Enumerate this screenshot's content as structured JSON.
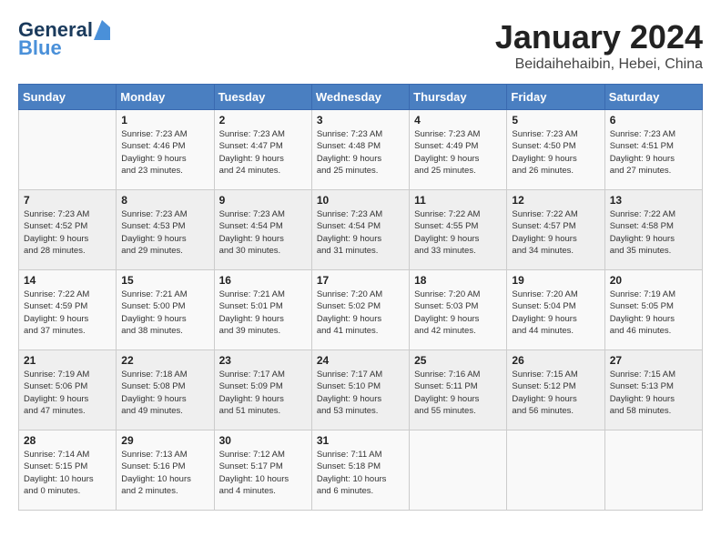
{
  "header": {
    "logo_general": "General",
    "logo_blue": "Blue",
    "month_title": "January 2024",
    "location": "Beidaihehaibin, Hebei, China"
  },
  "days_of_week": [
    "Sunday",
    "Monday",
    "Tuesday",
    "Wednesday",
    "Thursday",
    "Friday",
    "Saturday"
  ],
  "weeks": [
    [
      {
        "day": "",
        "info": ""
      },
      {
        "day": "1",
        "info": "Sunrise: 7:23 AM\nSunset: 4:46 PM\nDaylight: 9 hours\nand 23 minutes."
      },
      {
        "day": "2",
        "info": "Sunrise: 7:23 AM\nSunset: 4:47 PM\nDaylight: 9 hours\nand 24 minutes."
      },
      {
        "day": "3",
        "info": "Sunrise: 7:23 AM\nSunset: 4:48 PM\nDaylight: 9 hours\nand 25 minutes."
      },
      {
        "day": "4",
        "info": "Sunrise: 7:23 AM\nSunset: 4:49 PM\nDaylight: 9 hours\nand 25 minutes."
      },
      {
        "day": "5",
        "info": "Sunrise: 7:23 AM\nSunset: 4:50 PM\nDaylight: 9 hours\nand 26 minutes."
      },
      {
        "day": "6",
        "info": "Sunrise: 7:23 AM\nSunset: 4:51 PM\nDaylight: 9 hours\nand 27 minutes."
      }
    ],
    [
      {
        "day": "7",
        "info": "Sunrise: 7:23 AM\nSunset: 4:52 PM\nDaylight: 9 hours\nand 28 minutes."
      },
      {
        "day": "8",
        "info": "Sunrise: 7:23 AM\nSunset: 4:53 PM\nDaylight: 9 hours\nand 29 minutes."
      },
      {
        "day": "9",
        "info": "Sunrise: 7:23 AM\nSunset: 4:54 PM\nDaylight: 9 hours\nand 30 minutes."
      },
      {
        "day": "10",
        "info": "Sunrise: 7:23 AM\nSunset: 4:54 PM\nDaylight: 9 hours\nand 31 minutes."
      },
      {
        "day": "11",
        "info": "Sunrise: 7:22 AM\nSunset: 4:55 PM\nDaylight: 9 hours\nand 33 minutes."
      },
      {
        "day": "12",
        "info": "Sunrise: 7:22 AM\nSunset: 4:57 PM\nDaylight: 9 hours\nand 34 minutes."
      },
      {
        "day": "13",
        "info": "Sunrise: 7:22 AM\nSunset: 4:58 PM\nDaylight: 9 hours\nand 35 minutes."
      }
    ],
    [
      {
        "day": "14",
        "info": "Sunrise: 7:22 AM\nSunset: 4:59 PM\nDaylight: 9 hours\nand 37 minutes."
      },
      {
        "day": "15",
        "info": "Sunrise: 7:21 AM\nSunset: 5:00 PM\nDaylight: 9 hours\nand 38 minutes."
      },
      {
        "day": "16",
        "info": "Sunrise: 7:21 AM\nSunset: 5:01 PM\nDaylight: 9 hours\nand 39 minutes."
      },
      {
        "day": "17",
        "info": "Sunrise: 7:20 AM\nSunset: 5:02 PM\nDaylight: 9 hours\nand 41 minutes."
      },
      {
        "day": "18",
        "info": "Sunrise: 7:20 AM\nSunset: 5:03 PM\nDaylight: 9 hours\nand 42 minutes."
      },
      {
        "day": "19",
        "info": "Sunrise: 7:20 AM\nSunset: 5:04 PM\nDaylight: 9 hours\nand 44 minutes."
      },
      {
        "day": "20",
        "info": "Sunrise: 7:19 AM\nSunset: 5:05 PM\nDaylight: 9 hours\nand 46 minutes."
      }
    ],
    [
      {
        "day": "21",
        "info": "Sunrise: 7:19 AM\nSunset: 5:06 PM\nDaylight: 9 hours\nand 47 minutes."
      },
      {
        "day": "22",
        "info": "Sunrise: 7:18 AM\nSunset: 5:08 PM\nDaylight: 9 hours\nand 49 minutes."
      },
      {
        "day": "23",
        "info": "Sunrise: 7:17 AM\nSunset: 5:09 PM\nDaylight: 9 hours\nand 51 minutes."
      },
      {
        "day": "24",
        "info": "Sunrise: 7:17 AM\nSunset: 5:10 PM\nDaylight: 9 hours\nand 53 minutes."
      },
      {
        "day": "25",
        "info": "Sunrise: 7:16 AM\nSunset: 5:11 PM\nDaylight: 9 hours\nand 55 minutes."
      },
      {
        "day": "26",
        "info": "Sunrise: 7:15 AM\nSunset: 5:12 PM\nDaylight: 9 hours\nand 56 minutes."
      },
      {
        "day": "27",
        "info": "Sunrise: 7:15 AM\nSunset: 5:13 PM\nDaylight: 9 hours\nand 58 minutes."
      }
    ],
    [
      {
        "day": "28",
        "info": "Sunrise: 7:14 AM\nSunset: 5:15 PM\nDaylight: 10 hours\nand 0 minutes."
      },
      {
        "day": "29",
        "info": "Sunrise: 7:13 AM\nSunset: 5:16 PM\nDaylight: 10 hours\nand 2 minutes."
      },
      {
        "day": "30",
        "info": "Sunrise: 7:12 AM\nSunset: 5:17 PM\nDaylight: 10 hours\nand 4 minutes."
      },
      {
        "day": "31",
        "info": "Sunrise: 7:11 AM\nSunset: 5:18 PM\nDaylight: 10 hours\nand 6 minutes."
      },
      {
        "day": "",
        "info": ""
      },
      {
        "day": "",
        "info": ""
      },
      {
        "day": "",
        "info": ""
      }
    ]
  ]
}
